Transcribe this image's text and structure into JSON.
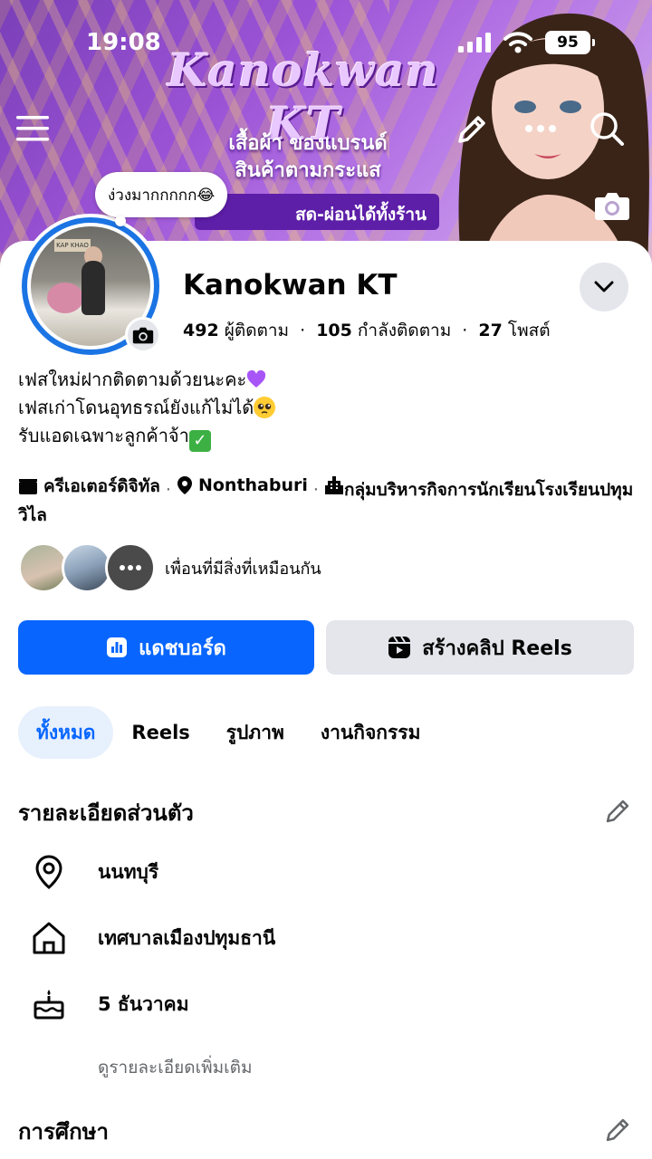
{
  "status_bar": {
    "time": "19:08",
    "battery": "95"
  },
  "cover": {
    "banner_title": "Kanokwan KT",
    "banner_line1": "เสื้อผ้า ของแบรนด์",
    "banner_line2": "สินค้าตามกระแส",
    "banner_line3": "สด-ผ่อนได้ทั้งร้าน"
  },
  "note": {
    "text": "ง่วงมากกกกก😂"
  },
  "profile": {
    "name": "Kanokwan KT",
    "followers_count": "492",
    "followers_label": "ผู้ติดตาม",
    "following_count": "105",
    "following_label": "กำลังติดตาม",
    "posts_count": "27",
    "posts_label": "โพสต์",
    "bio_line1": "เฟสใหม่ฝากติดตามด้วยนะคะ",
    "bio_line2": "เฟสเก่าโดนอุทธรณ์ยังแก้ไม่ได้",
    "bio_line3": "รับแอดเฉพาะลูกค้าจ้า",
    "category": "ครีเอเตอร์ดิจิทัล",
    "location": "Nonthaburi",
    "organization": "กลุ่มบริหารกิจการนักเรียนโรงเรียนปทุมวิไล",
    "mutual_label": "เพื่อนที่มีสิ่งที่เหมือนกัน"
  },
  "actions": {
    "dashboard_label": "แดชบอร์ด",
    "reels_label": "สร้างคลิป Reels"
  },
  "tabs": [
    {
      "label": "ทั้งหมด",
      "active": true
    },
    {
      "label": "Reels",
      "active": false
    },
    {
      "label": "รูปภาพ",
      "active": false
    },
    {
      "label": "งานกิจกรรม",
      "active": false
    }
  ],
  "details": {
    "title": "รายละเอียดส่วนตัว",
    "items": [
      {
        "icon": "location-pin-icon",
        "text": "นนทบุรี"
      },
      {
        "icon": "home-icon",
        "text": "เทศบาลเมืองปทุมธานี"
      },
      {
        "icon": "birthday-cake-icon",
        "text": "5 ธันวาคม"
      }
    ],
    "see_more": "ดูรายละเอียดเพิ่มเติม"
  },
  "education": {
    "title": "การศึกษา"
  },
  "colors": {
    "primary": "#0866ff",
    "secondary_button": "#e4e6eb",
    "active_tab_bg": "#e7f0fd",
    "ring": "#1b74e4"
  }
}
